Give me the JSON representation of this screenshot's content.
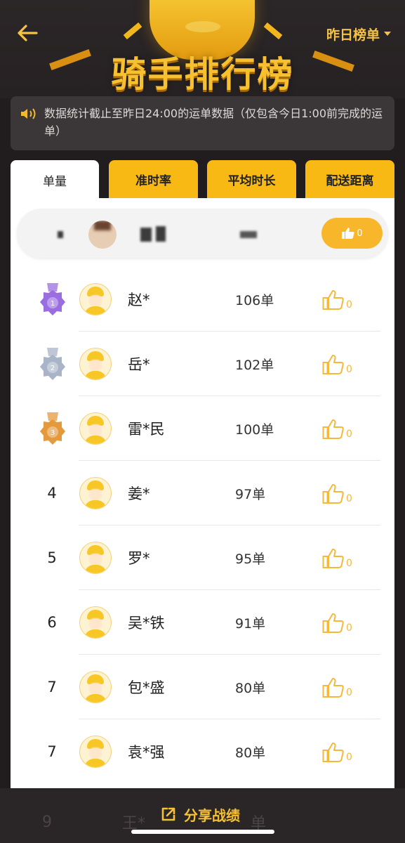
{
  "header": {
    "title": "骑手排行榜",
    "range_select": "昨日榜单"
  },
  "notice": {
    "text": "数据统计截止至昨日24:00的运单数据（仅包含今日1:00前完成的运单）"
  },
  "tabs": [
    {
      "label": "单量",
      "active": true
    },
    {
      "label": "准时率",
      "active": false
    },
    {
      "label": "平均时长",
      "active": false
    },
    {
      "label": "配送距离",
      "active": false
    }
  ],
  "my_row": {
    "like_count": "0"
  },
  "riders": [
    {
      "rank": "1",
      "medal": "purple",
      "name": "赵*",
      "orders": "106单",
      "likes": "0"
    },
    {
      "rank": "2",
      "medal": "silver",
      "name": "岳*",
      "orders": "102单",
      "likes": "0"
    },
    {
      "rank": "3",
      "medal": "bronze",
      "name": "雷*民",
      "orders": "100单",
      "likes": "0"
    },
    {
      "rank": "4",
      "medal": "",
      "name": "姜*",
      "orders": "97单",
      "likes": "0"
    },
    {
      "rank": "5",
      "medal": "",
      "name": "罗*",
      "orders": "95单",
      "likes": "0"
    },
    {
      "rank": "6",
      "medal": "",
      "name": "吴*铁",
      "orders": "91单",
      "likes": "0"
    },
    {
      "rank": "7",
      "medal": "",
      "name": "包*盛",
      "orders": "80单",
      "likes": "0"
    },
    {
      "rank": "7",
      "medal": "",
      "name": "袁*强",
      "orders": "80单",
      "likes": "0"
    }
  ],
  "medal_colors": {
    "purple": "#9a6ee0",
    "silver": "#aab4c8",
    "bronze": "#e49a3c"
  },
  "bottom": {
    "share_label": "分享战绩",
    "partial_row": {
      "rank": "9",
      "name": "王*",
      "orders": "单"
    }
  },
  "colors": {
    "accent": "#f8b915",
    "background": "#211d1f",
    "title": "#f7c031"
  }
}
